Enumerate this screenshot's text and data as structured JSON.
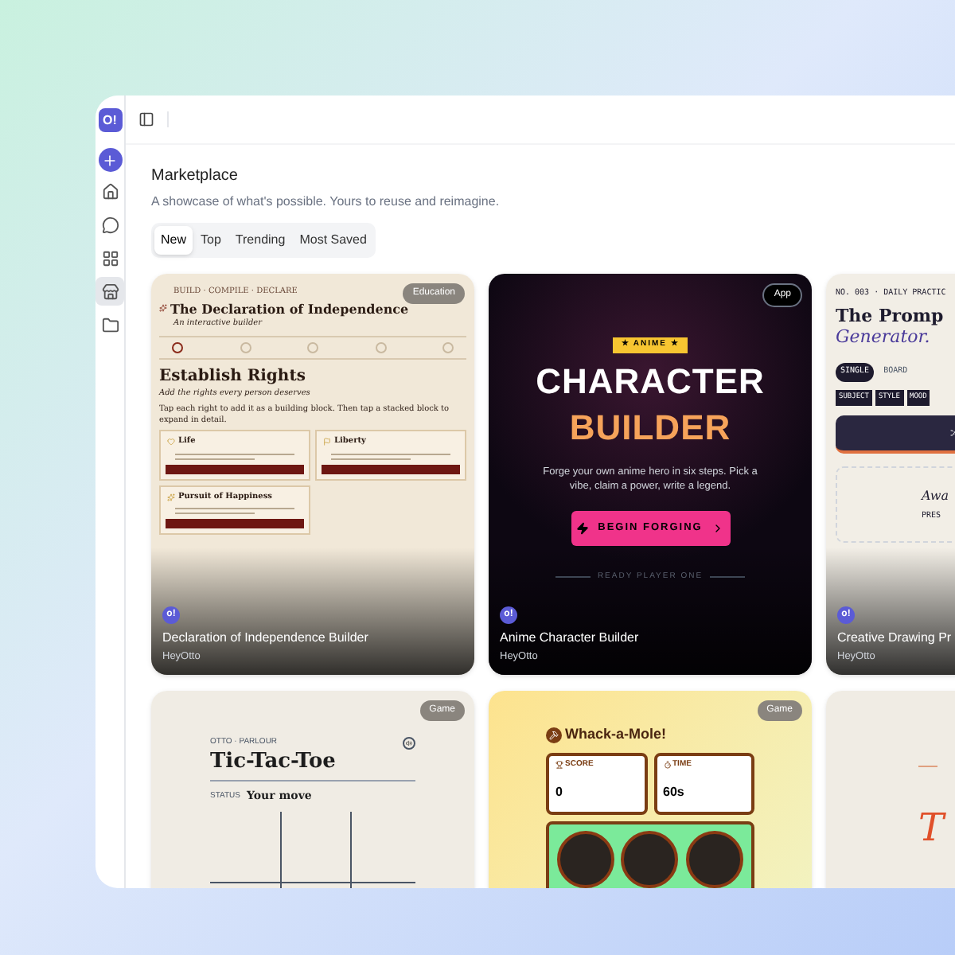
{
  "sidebar": {
    "logo": "O!",
    "items": [
      {
        "kind": "new",
        "selected": false
      },
      {
        "kind": "home",
        "selected": false
      },
      {
        "kind": "chat",
        "selected": false
      },
      {
        "kind": "apps",
        "selected": false
      },
      {
        "kind": "store",
        "selected": true
      },
      {
        "kind": "folder",
        "selected": false
      }
    ]
  },
  "page": {
    "title": "Marketplace",
    "subtitle": "A showcase of what's possible. Yours to reuse and reimagine."
  },
  "tabs": [
    {
      "label": "New",
      "selected": true
    },
    {
      "label": "Top",
      "selected": false
    },
    {
      "label": "Trending",
      "selected": false
    },
    {
      "label": "Most Saved",
      "selected": false
    }
  ],
  "cards": [
    {
      "kind": "declaration",
      "badge": "Education",
      "avatar": "o!",
      "title": "Declaration of Independence Builder",
      "author": "HeyOtto",
      "preview": {
        "eyebrow": "BUILD · COMPILE · DECLARE",
        "heading": "The Declaration of Independence",
        "sub": "An interactive builder",
        "section": "Establish Rights",
        "section_sub": "Add the rights every person deserves",
        "instruction": "Tap each right to add it as a building block. Then tap a stacked block to expand in detail.",
        "rights": [
          {
            "name": "Life"
          },
          {
            "name": "Liberty"
          },
          {
            "name": "Pursuit of Happiness"
          }
        ]
      }
    },
    {
      "kind": "anime",
      "badge": "App",
      "avatar": "o!",
      "title": "Anime Character Builder",
      "author": "HeyOtto",
      "preview": {
        "tag": "★ ANIME ★",
        "line1": "CHARACTER",
        "line2": "BUILDER",
        "desc": "Forge your own anime hero in six steps. Pick a vibe, claim a power, write a legend.",
        "button": "BEGIN FORGING",
        "footer": "READY PLAYER ONE"
      }
    },
    {
      "kind": "prompt",
      "avatar": "o!",
      "title": "Creative Drawing Pr",
      "author": "HeyOtto",
      "preview": {
        "eyebrow": "NO. 003 · DAILY PRACTIC",
        "heading": "The Promp",
        "heading2": "Generator.",
        "modes": [
          "SINGLE",
          "BOARD"
        ],
        "chips": [
          "SUBJECT",
          "STYLE",
          "MOOD"
        ],
        "result": "Awa",
        "hint": "PRES"
      }
    },
    {
      "kind": "tictactoe",
      "badge": "Game",
      "preview": {
        "eyebrow": "OTTO · PARLOUR",
        "heading": "Tic-Tac-Toe",
        "status_label": "STATUS",
        "status": "Your move"
      }
    },
    {
      "kind": "mole",
      "badge": "Game",
      "preview": {
        "heading": "Whack-a-Mole!",
        "stats": [
          {
            "label": "SCORE",
            "value": "0"
          },
          {
            "label": "TIME",
            "value": "60s"
          }
        ]
      }
    },
    {
      "kind": "quote",
      "preview": {
        "letter": "T"
      }
    }
  ]
}
